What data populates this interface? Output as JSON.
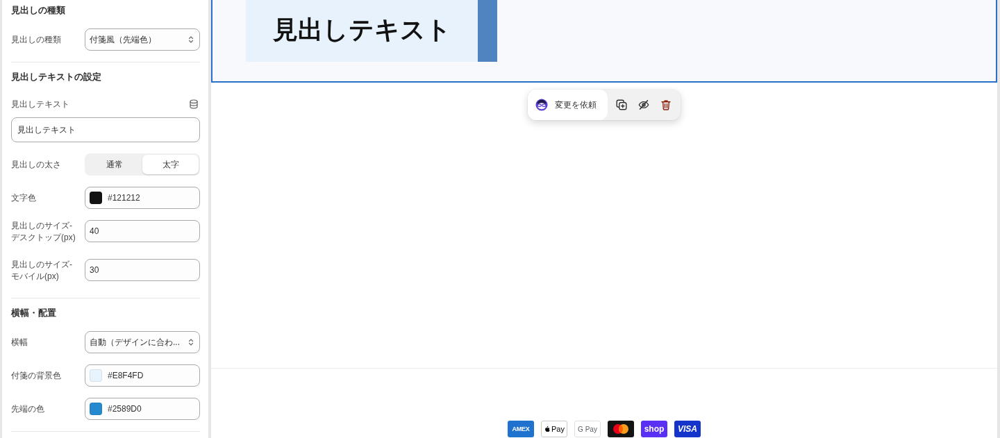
{
  "settings_panel": {
    "sections": [
      {
        "title": "見出しの種類",
        "fields": [
          {
            "kind": "select",
            "label": "見出しの種類",
            "value": "付箋風（先端色）"
          }
        ]
      },
      {
        "title": "見出しテキストの設定",
        "fields": [
          {
            "kind": "text",
            "label": "見出しテキスト",
            "value": "見出しテキスト",
            "dynamic_source": true
          },
          {
            "kind": "segmented",
            "label": "見出しの太さ",
            "options": [
              {
                "label": "通常",
                "selected": false
              },
              {
                "label": "太字",
                "selected": true
              }
            ]
          },
          {
            "kind": "color",
            "label": "文字色",
            "value": "#121212"
          },
          {
            "kind": "number",
            "label": "見出しのサイズ-デスクトップ(px)",
            "value": "40"
          },
          {
            "kind": "number",
            "label": "見出しのサイズ-モバイル(px)",
            "value": "30"
          }
        ]
      },
      {
        "title": "横幅・配置",
        "fields": [
          {
            "kind": "select",
            "label": "横幅",
            "value": "自動（デザインに合わ..."
          },
          {
            "kind": "color",
            "label": "付箋の背景色",
            "value": "#E8F4FD"
          },
          {
            "kind": "color",
            "label": "先端の色",
            "value": "#2589D0"
          }
        ]
      }
    ]
  },
  "preview": {
    "selected": true,
    "heading": {
      "text": "見出しテキスト"
    }
  },
  "floating_toolbar": {
    "request_button": {
      "label": "変更を依頼"
    },
    "actions": [
      {
        "kind": "duplicate"
      },
      {
        "kind": "hide"
      },
      {
        "kind": "delete"
      }
    ]
  },
  "footer": {
    "payment_methods": [
      {
        "kind": "amex",
        "label": "AMEX"
      },
      {
        "kind": "apple_pay",
        "label": "Pay"
      },
      {
        "kind": "google_pay",
        "label": "G Pay"
      },
      {
        "kind": "mastercard"
      },
      {
        "kind": "shop_pay",
        "label": "shop"
      },
      {
        "kind": "visa",
        "label": "VISA"
      }
    ]
  }
}
